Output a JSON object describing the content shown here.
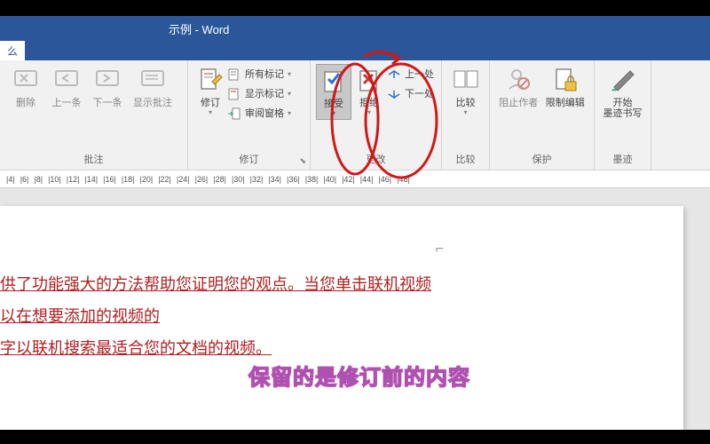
{
  "titlebar": {
    "title": "示例 - Word"
  },
  "tabrow": {
    "active_tab": "么"
  },
  "ribbon": {
    "groups": {
      "comments": {
        "label": "批注",
        "delete": "删除",
        "prev": "上一条",
        "next": "下一条",
        "show": "显示批注"
      },
      "tracking": {
        "label": "修订",
        "track": "修订",
        "display_dropdown": "所有标记",
        "show_markup": "显示标记",
        "review_pane": "审阅窗格"
      },
      "changes": {
        "label": "更改",
        "accept": "接受",
        "reject": "拒绝",
        "previous": "上一处",
        "next": "下一处"
      },
      "compare": {
        "label": "比较",
        "compare": "比较"
      },
      "protect": {
        "label": "保护",
        "block_authors": "阻止作者",
        "restrict_edit": "限制编辑"
      },
      "ink": {
        "label": "墨迹",
        "start_ink": "开始\n墨迹书写"
      }
    }
  },
  "ruler": [
    "|4|",
    "|6|",
    "|8|",
    "|10|",
    "|12|",
    "|14|",
    "|16|",
    "|18|",
    "|20|",
    "|22|",
    "|24|",
    "|26|",
    "|28|",
    "|30|",
    "|32|",
    "|34|",
    "|36|",
    "|38|",
    "|40|",
    "|42|",
    "|44|",
    "|46|",
    "|48|"
  ],
  "document": {
    "line1": "供了功能强大的方法帮助您证明您的观点。当您单击联机视频",
    "line2": "以在想要添加的视频的",
    "line3": "字以联机搜索最适合您的文档的视频。"
  },
  "overlay_caption": "保留的是修订前的内容"
}
